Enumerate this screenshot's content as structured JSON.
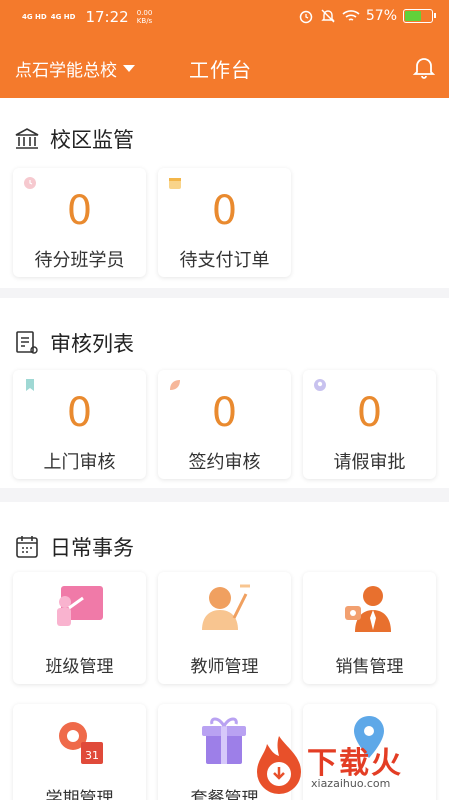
{
  "status_bar": {
    "sig1": "4G HD",
    "sig2": "4G HD",
    "time": "17:22",
    "netspeed_value": "0.00",
    "netspeed_unit": "KB/s",
    "battery": "57%",
    "battery_level": 0.57
  },
  "nav": {
    "school": "点石学能总校",
    "title": "工作台"
  },
  "campus": {
    "title": "校区监管",
    "cards": [
      {
        "value": "0",
        "label": "待分班学员"
      },
      {
        "value": "0",
        "label": "待支付订单"
      }
    ]
  },
  "review": {
    "title": "审核列表",
    "cards": [
      {
        "value": "0",
        "label": "上门审核"
      },
      {
        "value": "0",
        "label": "签约审核"
      },
      {
        "value": "0",
        "label": "请假审批"
      }
    ]
  },
  "daily": {
    "title": "日常事务",
    "items": [
      {
        "label": "班级管理",
        "icon": "classroom-icon"
      },
      {
        "label": "教师管理",
        "icon": "teacher-icon"
      },
      {
        "label": "销售管理",
        "icon": "sales-icon"
      },
      {
        "label": "学期管理",
        "icon": "semester-icon"
      },
      {
        "label": "套餐管理",
        "icon": "package-icon"
      },
      {
        "label": "",
        "icon": "location-icon"
      }
    ]
  },
  "watermark": {
    "brand": "下载火",
    "url": "xiazaihuo.com"
  },
  "colors": {
    "brand": "#f47a2c",
    "number": "#e98a2f"
  }
}
